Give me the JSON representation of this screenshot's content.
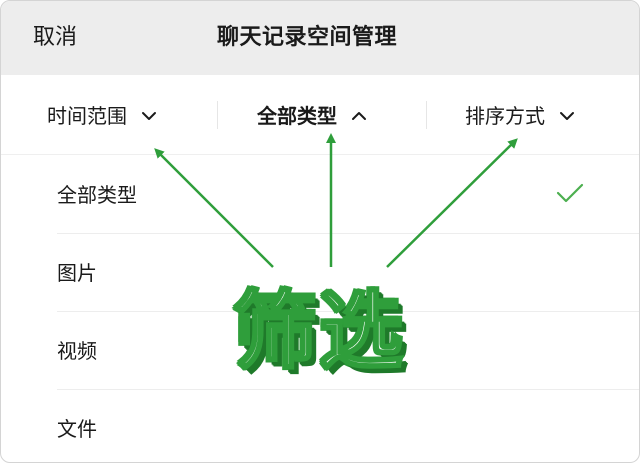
{
  "header": {
    "cancel_label": "取消",
    "title": "聊天记录空间管理"
  },
  "filters": [
    {
      "label": "时间范围",
      "chevron": "chevron-down-icon"
    },
    {
      "label": "全部类型",
      "chevron": "chevron-up-icon",
      "active": true
    },
    {
      "label": "排序方式",
      "chevron": "chevron-down-icon"
    }
  ],
  "list": {
    "items": [
      {
        "label": "全部类型",
        "selected": true
      },
      {
        "label": "图片"
      },
      {
        "label": "视频"
      },
      {
        "label": "文件"
      }
    ]
  },
  "annotation": {
    "text": "筛选",
    "arrow_color": "#2f9e3b"
  },
  "colors": {
    "header_bg": "#ededed",
    "check": "#4caf50",
    "annotation_green": "#2f9e3b"
  }
}
